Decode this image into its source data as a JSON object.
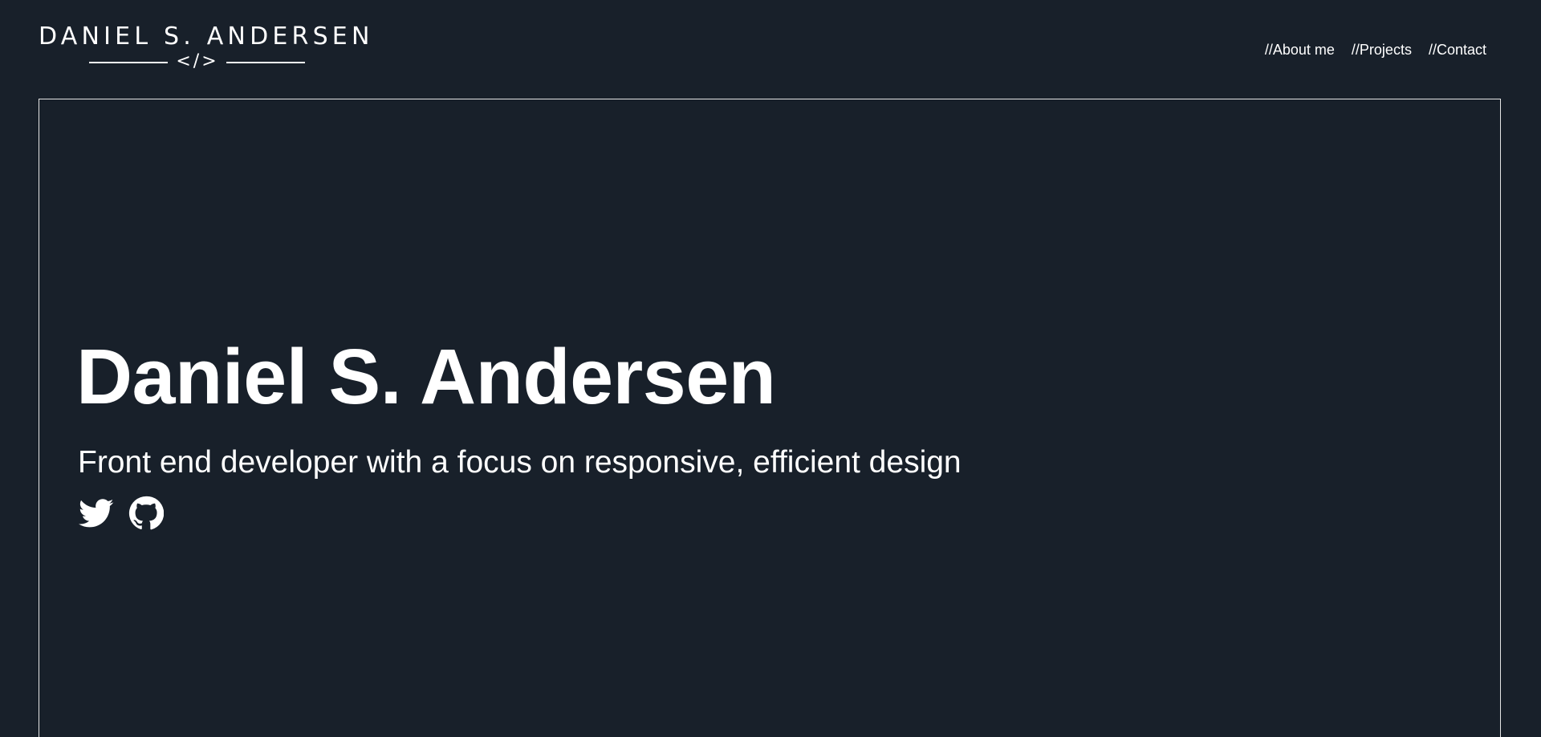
{
  "header": {
    "logo_name": "DANIEL S. ANDERSEN",
    "logo_code": "</>",
    "nav": [
      {
        "label": "//About me"
      },
      {
        "label": "//Projects"
      },
      {
        "label": "//Contact"
      }
    ]
  },
  "hero": {
    "title": "Daniel S. Andersen",
    "subtitle": "Front end developer with a focus on responsive, efficient design",
    "socials": [
      {
        "icon": "twitter-icon"
      },
      {
        "icon": "github-icon"
      }
    ]
  },
  "colors": {
    "background": "#18202a",
    "foreground": "#ffffff",
    "frame_border": "#e6e6e6"
  }
}
